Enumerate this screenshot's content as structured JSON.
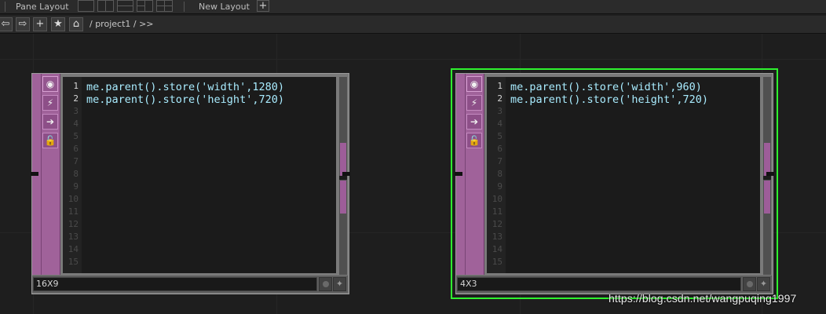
{
  "topbar": {
    "pane_layout_label": "Pane Layout",
    "new_layout_label": "New Layout",
    "add_symbol": "+"
  },
  "navbar": {
    "back_symbol": "⇦",
    "forward_symbol": "⇨",
    "add_symbol": "+",
    "bookmark_symbol": "★",
    "home_symbol": "⌂",
    "path": "/ project1 / >>"
  },
  "nodes": [
    {
      "name": "16X9",
      "selected": false,
      "lines": [
        "me.parent().store('width',1280)",
        "me.parent().store('height',720)"
      ],
      "line_numbers": [
        "1",
        "2",
        "3",
        "4",
        "5",
        "6",
        "7",
        "8",
        "9",
        "10",
        "11",
        "12",
        "13",
        "14",
        "15"
      ]
    },
    {
      "name": "4X3",
      "selected": true,
      "lines": [
        "me.parent().store('width',960)",
        "me.parent().store('height',720)"
      ],
      "line_numbers": [
        "1",
        "2",
        "3",
        "4",
        "5",
        "6",
        "7",
        "8",
        "9",
        "10",
        "11",
        "12",
        "13",
        "14",
        "15"
      ]
    }
  ],
  "sidebar_icons": [
    "viewer-icon",
    "cook-icon",
    "export-icon",
    "lock-icon"
  ],
  "colors": {
    "dat_sidebar": "#a0629a",
    "selection": "#2ef22e",
    "code_text": "#a9ecff"
  },
  "watermark": "https://blog.csdn.net/wangpuqing1997"
}
